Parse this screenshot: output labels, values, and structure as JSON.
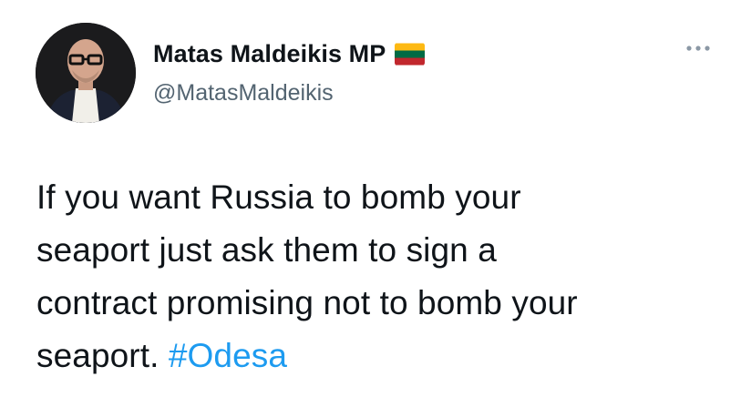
{
  "author": {
    "display_name": "Matas Maldeikis MP",
    "handle": "@MatasMaldeikis",
    "flag_icon": "lithuania-flag-icon",
    "avatar_icon": "profile-photo"
  },
  "menu": {
    "more_icon": "more-options-icon"
  },
  "tweet": {
    "lines": [
      "If you want Russia to bomb your",
      "seaport just ask them to sign a",
      "contract promising not to bomb your",
      "seaport. "
    ],
    "hashtag": "#Odesa"
  },
  "colors": {
    "text": "#0f1419",
    "secondary": "#536471",
    "link": "#1d9bf0",
    "flag_yellow": "#fdb913",
    "flag_green": "#006a44",
    "flag_red": "#c1272d"
  }
}
